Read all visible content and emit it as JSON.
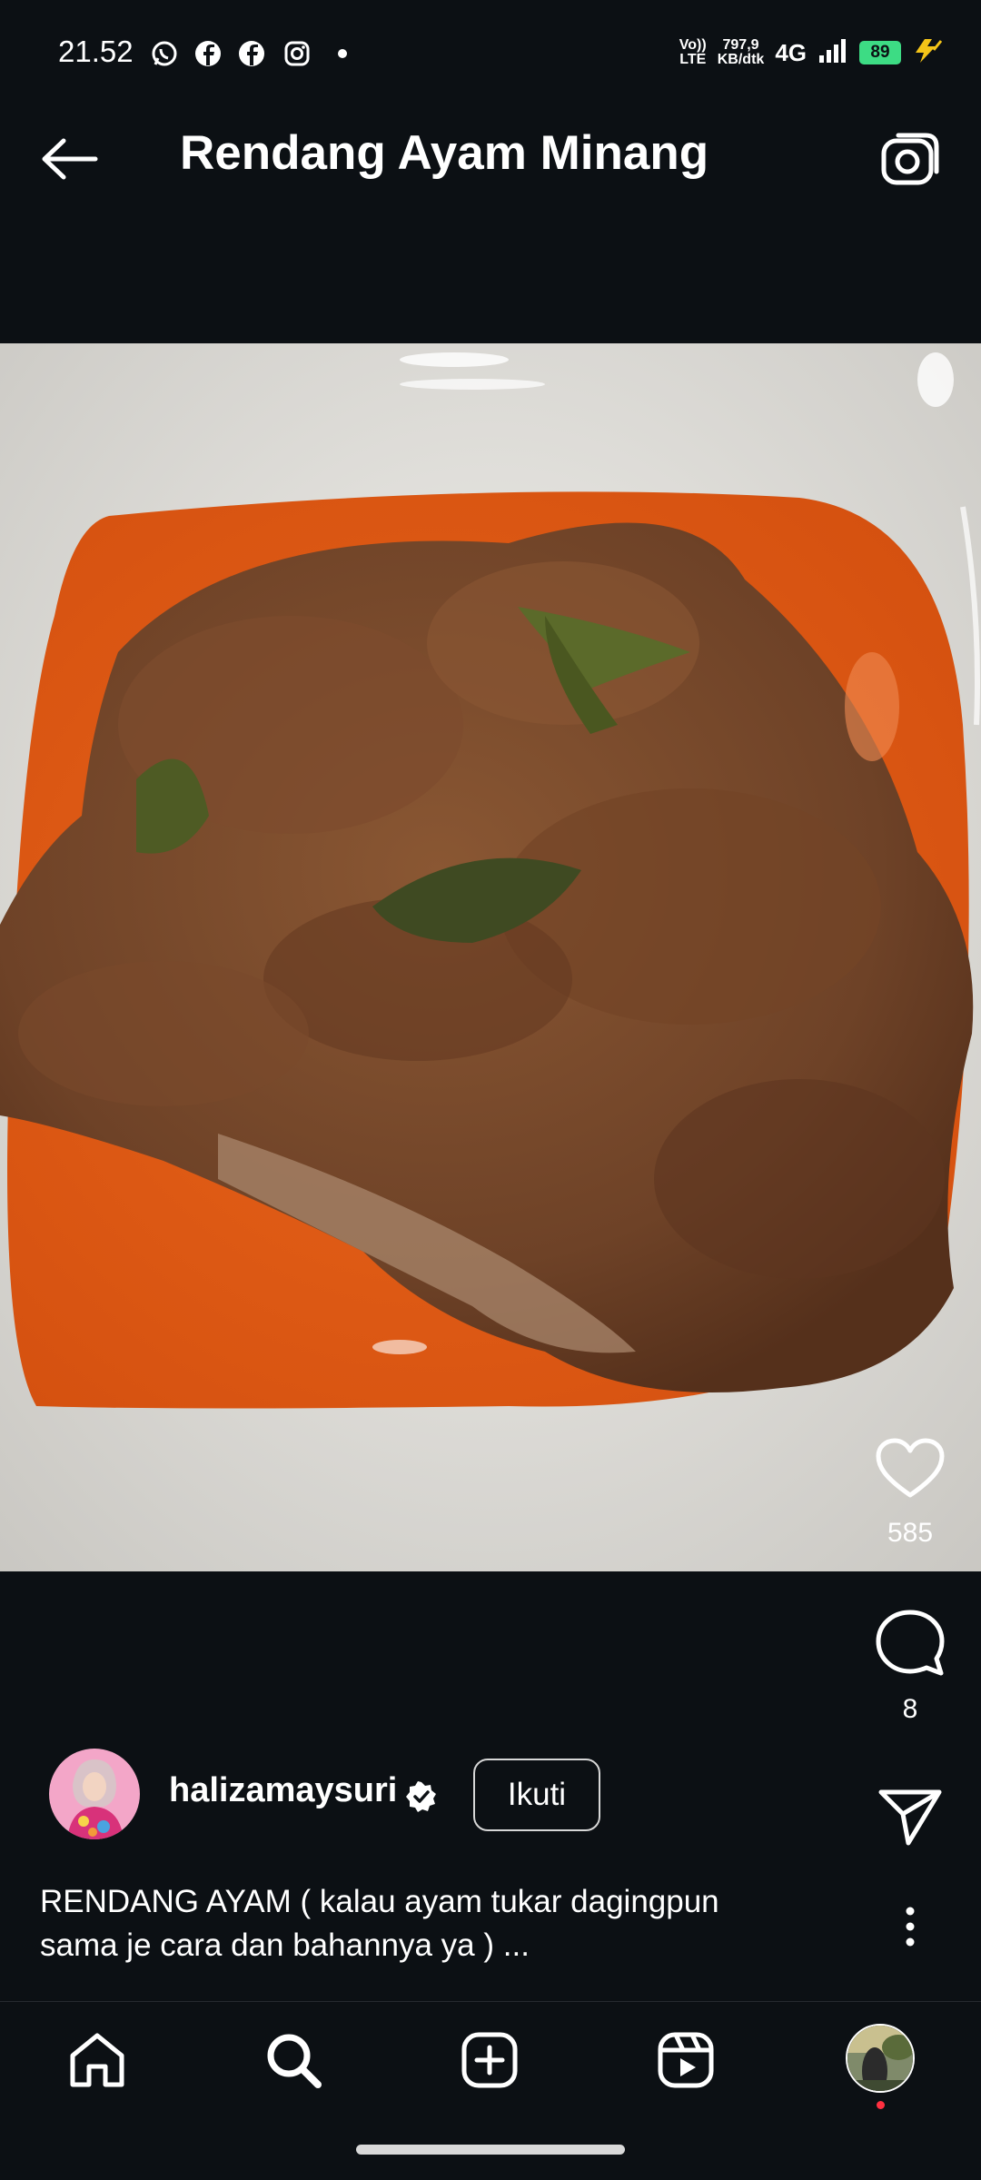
{
  "status_bar": {
    "time": "21.52",
    "notifications": [
      "whatsapp-icon",
      "facebook-icon",
      "facebook-icon",
      "instagram-icon",
      "dot-icon"
    ],
    "volte": "Vo)) LTE",
    "speed_value": "797,9",
    "speed_unit": "KB/dtk",
    "network": "4G",
    "battery": "89"
  },
  "header": {
    "title": "Rendang Ayam Minang"
  },
  "post": {
    "likes": "585",
    "comments": "8",
    "username": "halizamaysuri",
    "follow_label": "Ikuti",
    "caption_line1": "RENDANG AYAM ( kalau ayam tukar dagingpun",
    "caption_line2": "sama je cara dan bahannya ya ) ..."
  },
  "colors": {
    "background": "#0c1014",
    "sauce": "#e0621a",
    "rendang": "#7a4a2c",
    "plate": "#ecebe6",
    "notification_dot": "#ff3040",
    "battery": "#3ddc84"
  },
  "bottom_nav": [
    "home-icon",
    "search-icon",
    "create-icon",
    "reels-icon",
    "profile-avatar"
  ]
}
